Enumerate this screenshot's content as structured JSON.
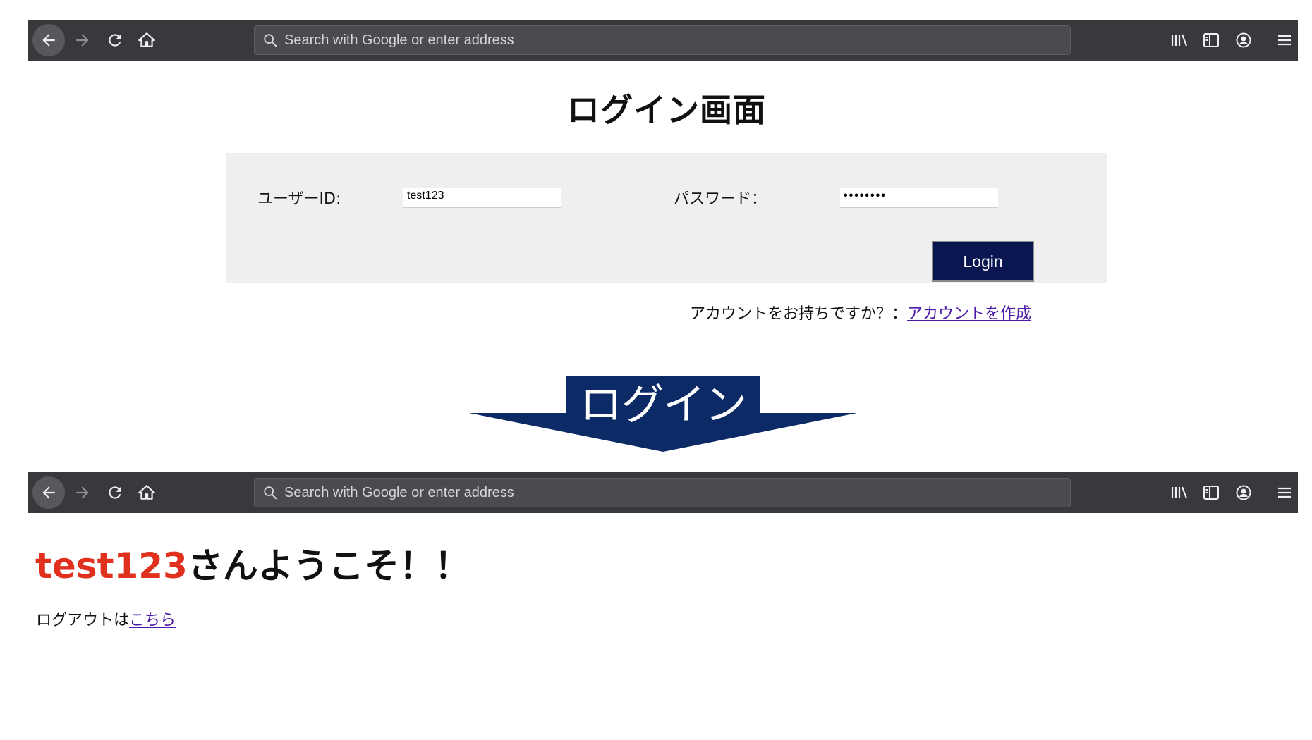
{
  "browser": {
    "url_placeholder": "Search with Google or enter address",
    "icons": [
      "back-icon",
      "forward-icon",
      "reload-icon",
      "home-icon",
      "search-icon",
      "library-icon",
      "sidebar-icon",
      "account-icon",
      "hamburger-menu-icon"
    ]
  },
  "login_page": {
    "title": "ログイン画面",
    "user_label": "ユーザーID:",
    "user_value": "test123",
    "password_label": "パスワード：",
    "password_value": "••••••••",
    "login_button": "Login",
    "signup_prompt": "アカウントをお持ちですか？：",
    "signup_link": "アカウントを作成"
  },
  "transition": {
    "label": "ログイン",
    "color": "#0b2a66"
  },
  "welcome_page": {
    "username": "test123",
    "greeting_suffix": "さんようこそ！！",
    "logout_prompt": "ログアウトは",
    "logout_link": "こちら"
  },
  "colors": {
    "toolbar": "#38383d",
    "login_button": "#0a1650",
    "username_highlight": "#e0301e",
    "link": "#4b1aa6"
  }
}
